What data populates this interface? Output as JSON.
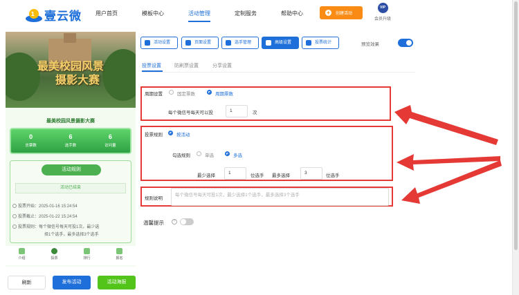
{
  "brand": {
    "name": "壹云微",
    "badge": "壹云"
  },
  "nav": {
    "items": [
      {
        "label": "用户首页",
        "active": false
      },
      {
        "label": "模板中心",
        "active": false
      },
      {
        "label": "活动管理",
        "active": true
      },
      {
        "label": "定制服务",
        "active": false
      },
      {
        "label": "帮助中心",
        "active": false
      }
    ],
    "create_label": "创建活动",
    "vip_badge": "VIP",
    "vip_label": "会员升级"
  },
  "preview": {
    "banner_title_1": "最美校园风景",
    "banner_title_2": "摄影大赛",
    "contest_name": "最美校园风景摄影大赛",
    "stats": [
      {
        "value": "0",
        "label": "总票数"
      },
      {
        "value": "6",
        "label": "选手数"
      },
      {
        "value": "6",
        "label": "访问量"
      }
    ],
    "rules_title": "活动规则",
    "ended": "活动已结束",
    "rules": [
      "投票开始：2025-01-16 15:24:54",
      "投票截止：2025-01-22 15:24:54",
      "投票规则：每个微信号每天可投1次，最少选",
      "择1个选手，最多选择3个选手"
    ],
    "tabs": [
      "介绍",
      "投票",
      "排行",
      "报名"
    ]
  },
  "bottom_buttons": {
    "refresh": "刷新",
    "publish": "发布活动",
    "poster": "活动海报"
  },
  "toolbar": {
    "buttons": [
      {
        "label": "活动设置",
        "active": false
      },
      {
        "label": "页面设置",
        "active": false
      },
      {
        "label": "选手管理",
        "active": false
      },
      {
        "label": "高级设置",
        "active": true
      },
      {
        "label": "投票统计",
        "active": false
      }
    ],
    "preview_label": "预览效果",
    "preview_on": true
  },
  "subtabs": [
    {
      "label": "投票设置",
      "active": true
    },
    {
      "label": "防刷票设置",
      "active": false
    },
    {
      "label": "分享设置",
      "active": false
    }
  ],
  "form": {
    "cycle": {
      "label": "周期设置",
      "options": [
        {
          "label": "固定票数",
          "selected": false
        },
        {
          "label": "周期票数",
          "selected": true
        }
      ],
      "per_day_prefix": "每个微信号每天可以投",
      "per_day_value": "1",
      "per_day_suffix": "次"
    },
    "rule": {
      "label": "投票规则",
      "by_activity": "按活动",
      "select_label": "勾选规则",
      "options": [
        {
          "label": "单选",
          "selected": false
        },
        {
          "label": "多选",
          "selected": true
        }
      ],
      "min_label": "最少选择",
      "min_value": "1",
      "min_unit": "位选手",
      "max_label": "最多选择",
      "max_value": "3",
      "max_unit": "位选手"
    },
    "desc": {
      "label": "规则说明",
      "placeholder": "每个微信号每天可投1次，最少选择1个选手，最多选择3个选手"
    },
    "tip": {
      "label": "温馨提示",
      "on": false
    }
  },
  "colors": {
    "primary": "#1e6fd9",
    "orange": "#fa8c16",
    "green": "#52c41a",
    "red": "#e53935"
  }
}
